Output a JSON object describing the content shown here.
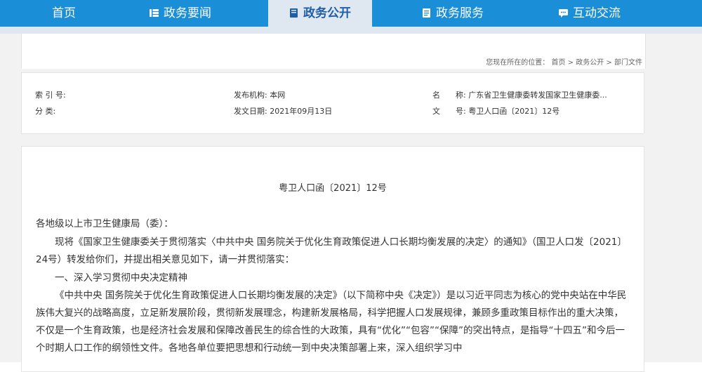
{
  "nav": {
    "items": [
      {
        "label": "首页",
        "icon": ""
      },
      {
        "label": "政务要闻",
        "icon": "grid-icon"
      },
      {
        "label": "政务公开",
        "icon": "book-icon"
      },
      {
        "label": "政务服务",
        "icon": "document-icon"
      },
      {
        "label": "互动交流",
        "icon": "chat-icon"
      }
    ],
    "active_index": 2,
    "colors": {
      "bar": "#1b8ed8",
      "active_bg": "#dfe8f1",
      "active_text": "#1f5fa8"
    }
  },
  "breadcrumb": {
    "prefix": "您现在所在的位置：",
    "items": [
      "首页",
      "政务公开",
      "部门文件"
    ],
    "separator": ">"
  },
  "meta": {
    "index_label": "索 引 号:",
    "index_value": "",
    "category_label": "分 类:",
    "category_value": "",
    "publisher": "发布机构: 本网",
    "date": "发文日期: 2021年09月13日",
    "name_label": "名　　称:",
    "name_value": "广东省卫生健康委转发国家卫生健康委...",
    "docnum_label": "文　　号:",
    "docnum_value": "粤卫人口函〔2021〕12号"
  },
  "article": {
    "doc_number": "粤卫人口函〔2021〕12号",
    "salutation": "各地级以上市卫生健康局（委）：",
    "intro": "现将《国家卫生健康委关于贯彻落实〈中共中央 国务院关于优化生育政策促进人口长期均衡发展的决定〉的通知》（国卫人口发〔2021〕24号）转发给你们，并提出相关意见如下，请一并贯彻落实：",
    "section1_title": "一、深入学习贯彻中央决定精神",
    "section1_body": "《中共中央 国务院关于优化生育政策促进人口长期均衡发展的决定》（以下简称中央《决定》）是以习近平同志为核心的党中央站在中华民族伟大复兴的战略高度，立足新发展阶段，贯彻新发展理念，构建新发展格局，科学把握人口发展规律，兼顾多重政策目标作出的重大决策，不仅是一个生育政策，也是经济社会发展和保障改善民生的综合性的大政策，具有“优化”“包容”“保障”的突出特点，是指导“十四五”和今后一个时期人口工作的纲领性文件。各地各单位要把思想和行动统一到中央决策部署上来，深入组织学习中"
  }
}
